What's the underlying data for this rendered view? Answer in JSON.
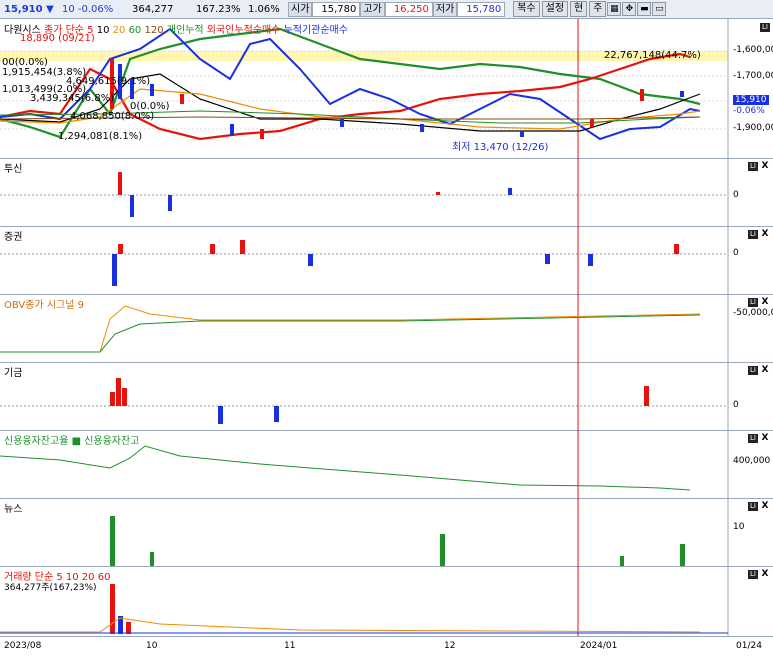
{
  "header": {
    "price": "15,910 ▼",
    "change": "10 -0.06%",
    "volume": "364,277",
    "volume_rate": "167.23%",
    "turnover": "1.06%",
    "open_label": "시가",
    "open": "15,780",
    "high_label": "고가",
    "high": "16,250",
    "low_label": "저가",
    "low": "15,780",
    "buttons": [
      "복수",
      "설정",
      "현",
      "주"
    ]
  },
  "main_pane": {
    "legend": [
      "다원시스",
      "종가 단순 5",
      "10",
      "20",
      "60",
      "120",
      "개인누적",
      "외국인누적순매수",
      "누적기관순매수"
    ],
    "price_labels": [
      "-1,600,00",
      "-1,700,00",
      "-1,800,00",
      "-1,900,00"
    ],
    "current_price_tag": "15,910",
    "current_change_tag": "-0.06%",
    "high_annotation": "18,890 (09/21)",
    "low_annotation": "최저 13,470 (12/26)",
    "right_annotation": "22,767,148(44.7%)",
    "left_annotations": [
      "00(0.0%)",
      "1,915,454(3.8%)",
      "4,649,615(9.1%)",
      "1,013,499(2.0%)",
      "3,439,345(6.8%)",
      "4,068,850(8.0%)",
      "1,294,081(8.1%)",
      "0(0.0%)"
    ]
  },
  "panes": {
    "trust": {
      "title": "투신",
      "axis": "0"
    },
    "securities": {
      "title": "증권",
      "axis": "0"
    },
    "obv": {
      "title": "OBV종가 시그널 9",
      "axis": "-50,000,00"
    },
    "pension": {
      "title": "기금",
      "axis": "0"
    },
    "credit": {
      "title": "신용융자잔고율 ■ 신용융자잔고",
      "axis": "400,000"
    },
    "news": {
      "title": "뉴스",
      "axis": "10"
    },
    "volume": {
      "title": "거래량 단순 5 10 20 60",
      "subtitle": "364,277주(167,23%)"
    }
  },
  "x_axis": [
    "2023/08",
    "10",
    "11",
    "12",
    "2024/01",
    "01/24"
  ],
  "colors": {
    "up": "#e8120c",
    "down": "#1a2fe0",
    "ma5": "#e8120c",
    "ma10": "#000000",
    "ma20": "#f08c00",
    "ma60": "#1f8f2a",
    "ma120": "#8b4513"
  }
}
